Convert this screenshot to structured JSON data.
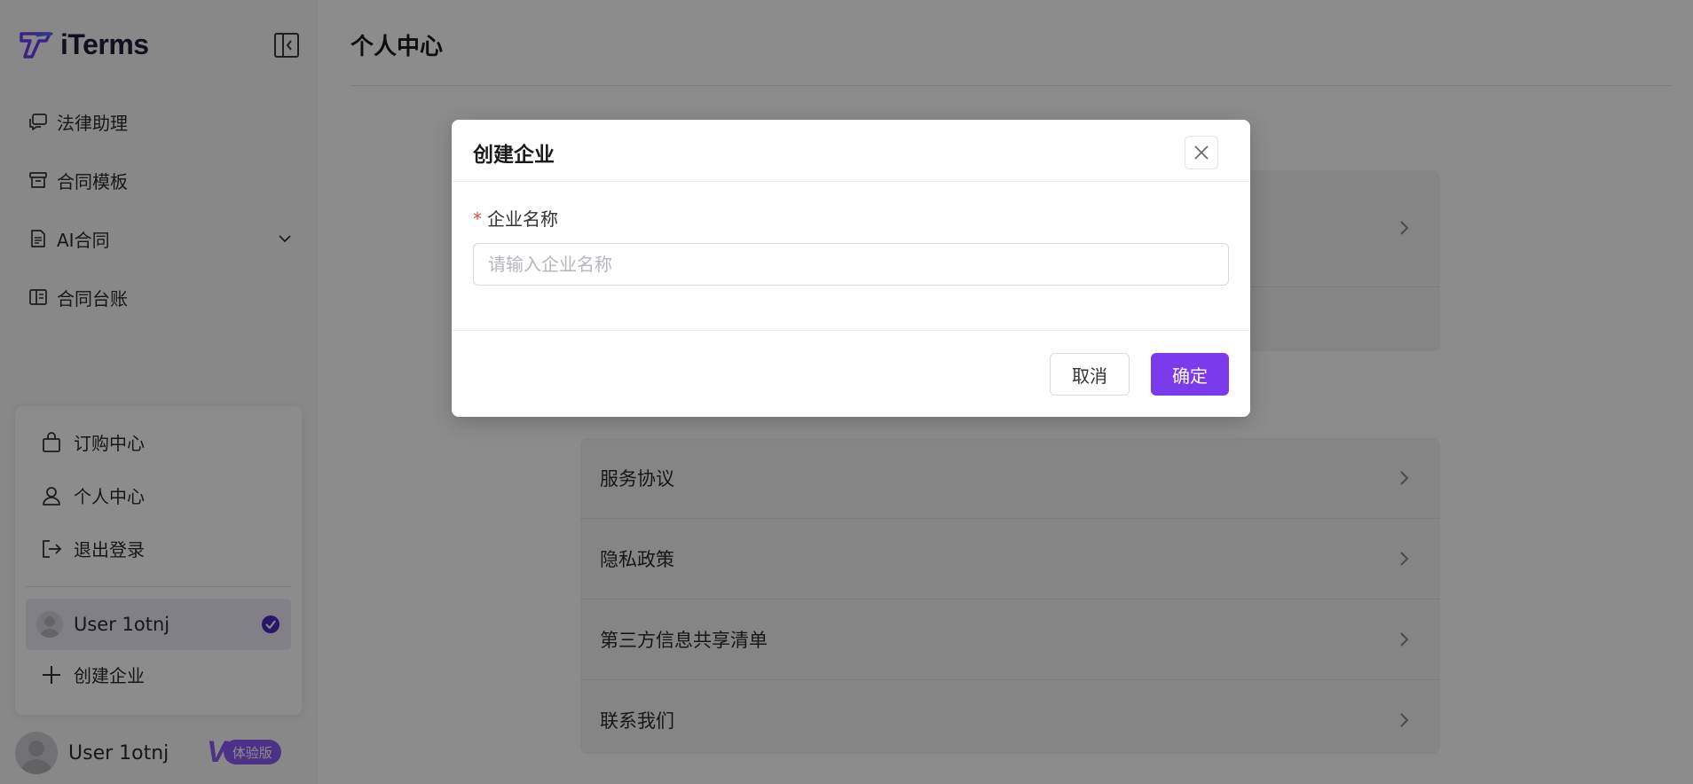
{
  "colors": {
    "accent": "#7c3aed",
    "required": "#e5484d",
    "overlay": "rgba(0,0,0,0.45)"
  },
  "sidebar": {
    "brand": "iTerms",
    "nav": [
      {
        "label": "法律助理",
        "icon": "chat-icon"
      },
      {
        "label": "合同模板",
        "icon": "archive-icon"
      },
      {
        "label": "AI合同",
        "icon": "document-icon",
        "expandable": true
      },
      {
        "label": "合同台账",
        "icon": "book-icon"
      }
    ],
    "menu": {
      "order_center": "订购中心",
      "profile": "个人中心",
      "logout": "退出登录",
      "current_org": "User 1otnj",
      "create_org": "创建企业"
    },
    "user": {
      "name": "User 1otnj",
      "badge_letter": "V",
      "badge": "体验版"
    }
  },
  "main": {
    "title": "个人中心",
    "list": [
      "服务协议",
      "隐私政策",
      "第三方信息共享清单",
      "联系我们"
    ]
  },
  "modal": {
    "title": "创建企业",
    "field_required_mark": "*",
    "field_label": "企业名称",
    "field_placeholder": "请输入企业名称",
    "field_value": "",
    "cancel": "取消",
    "confirm": "确定"
  }
}
